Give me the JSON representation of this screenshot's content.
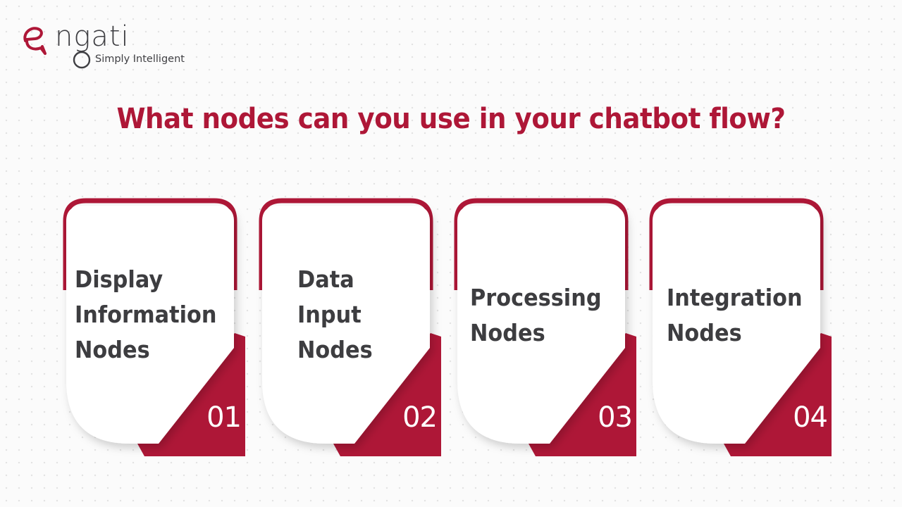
{
  "brand": {
    "name": "ngati",
    "tagline": "Simply Intelligent",
    "accent_color": "#ae1737",
    "logo_icon": "chat-bubble-e-icon"
  },
  "headline": "What nodes can you use in your chatbot flow?",
  "cards": [
    {
      "number": "01",
      "title": "Display\nInformation\nNodes"
    },
    {
      "number": "02",
      "title": "Data\nInput\nNodes"
    },
    {
      "number": "03",
      "title": "Processing\nNodes"
    },
    {
      "number": "04",
      "title": "Integration\nNodes"
    }
  ],
  "colors": {
    "accent": "#ae1737",
    "text_dark": "#3d3d40",
    "card_bg": "#ffffff"
  }
}
